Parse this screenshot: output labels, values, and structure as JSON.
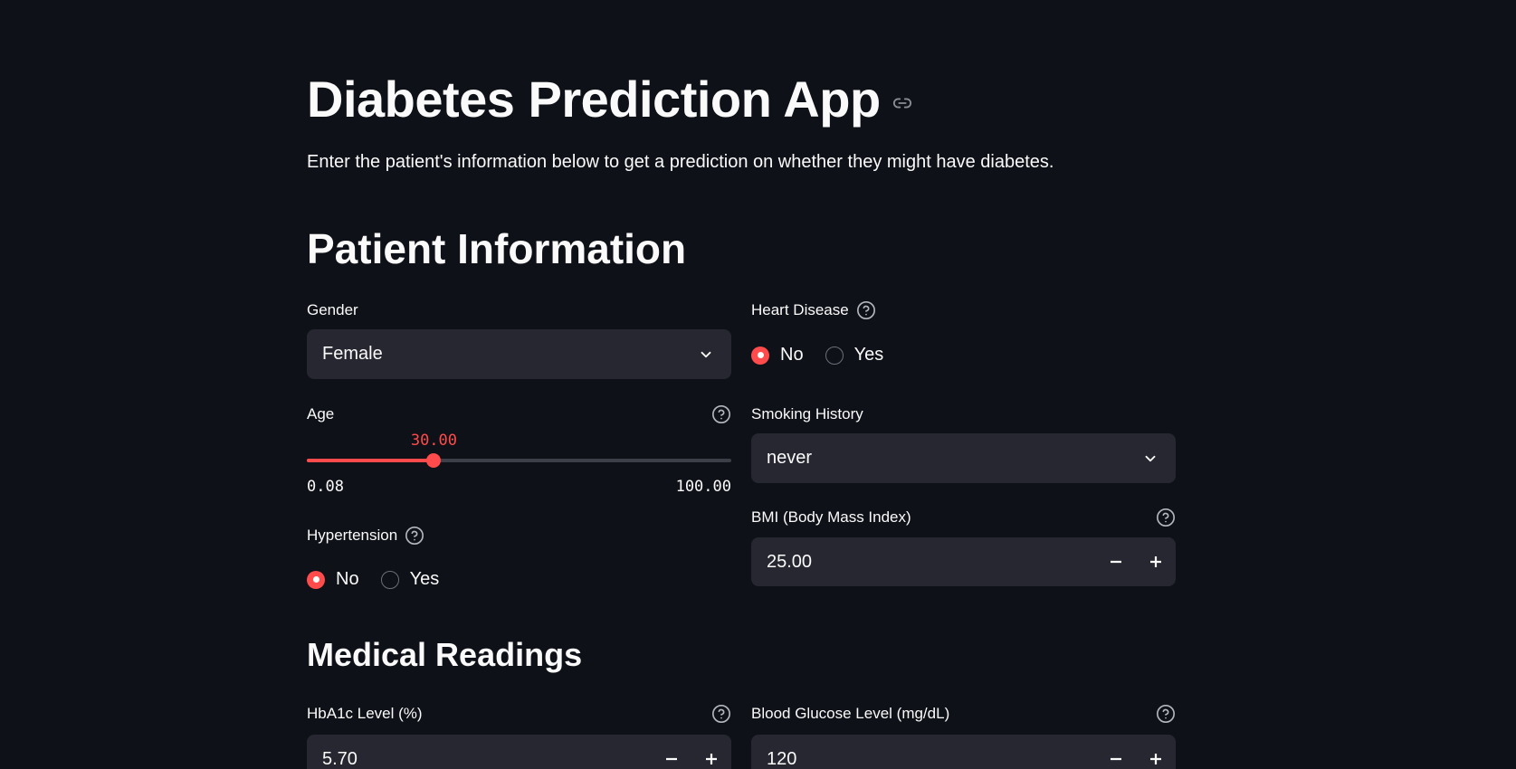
{
  "header": {
    "title": "Diabetes Prediction App",
    "subtitle": "Enter the patient's information below to get a prediction on whether they might have diabetes."
  },
  "sections": {
    "patient_info": "Patient Information",
    "medical_readings": "Medical Readings"
  },
  "gender": {
    "label": "Gender",
    "value": "Female"
  },
  "age": {
    "label": "Age",
    "value": "30.00",
    "min": "0.08",
    "max": "100.00",
    "value_num": 30.0,
    "min_num": 0.08,
    "max_num": 100.0
  },
  "hypertension": {
    "label": "Hypertension",
    "options": [
      "No",
      "Yes"
    ],
    "selected": "No"
  },
  "heart_disease": {
    "label": "Heart Disease",
    "options": [
      "No",
      "Yes"
    ],
    "selected": "No"
  },
  "smoking_history": {
    "label": "Smoking History",
    "value": "never"
  },
  "bmi": {
    "label": "BMI (Body Mass Index)",
    "value": "25.00"
  },
  "hba1c": {
    "label": "HbA1c Level (%)",
    "value": "5.70"
  },
  "glucose": {
    "label": "Blood Glucose Level (mg/dL)",
    "value": "120"
  },
  "colors": {
    "accent": "#ff4b4b",
    "background": "#0e1117",
    "input_bg": "#262730",
    "text": "#fafafa"
  },
  "icons": {
    "anchor": "link-icon",
    "help": "help-circle-icon",
    "dropdown": "chevron-down-icon",
    "minus": "minus-icon",
    "plus": "plus-icon"
  }
}
